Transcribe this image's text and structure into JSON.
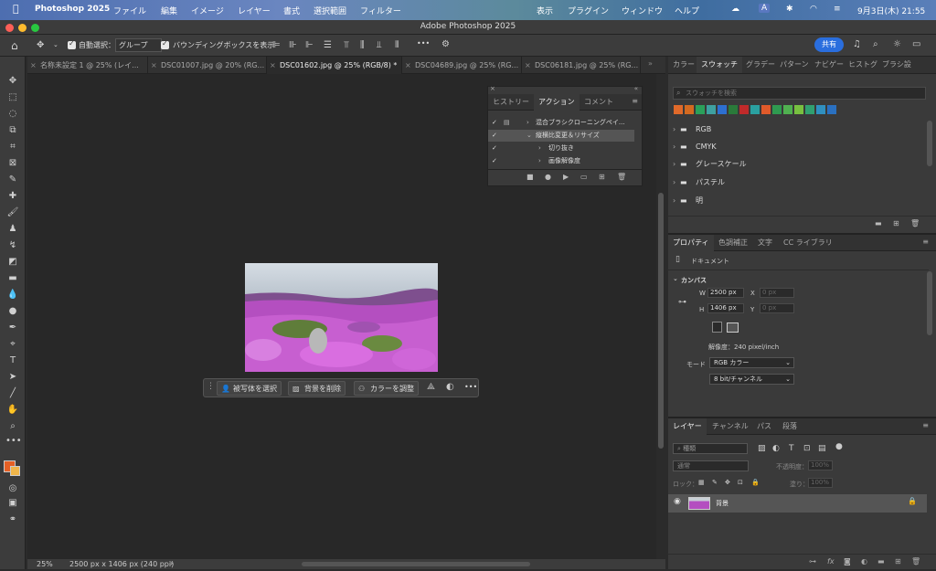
{
  "menubar": {
    "app": "Photoshop 2025",
    "items": [
      "ファイル",
      "編集",
      "イメージ",
      "レイヤー",
      "書式",
      "選択範囲",
      "フィルター"
    ],
    "right_items": [
      "表示",
      "プラグイン",
      "ウィンドウ",
      "ヘルプ"
    ],
    "input_indicator": "A",
    "datetime": "9月3日(木) 21:55"
  },
  "window": {
    "title": "Adobe Photoshop 2025"
  },
  "options": {
    "auto_select_label": "自動選択：",
    "auto_select_value": "グループ",
    "bbox_label": "バウンディングボックスを表示",
    "more": "•••",
    "share_label": "共有"
  },
  "tabs": [
    {
      "label": "名称未設定 1 @ 25% (レイ...",
      "active": false
    },
    {
      "label": "DSC01007.jpg @ 20% (RG...",
      "active": false
    },
    {
      "label": "DSC01602.jpg @ 25% (RGB/8) *",
      "active": true
    },
    {
      "label": "DSC04689.jpg @ 25% (RG...",
      "active": false
    },
    {
      "label": "DSC06181.jpg @ 25% (RG...",
      "active": false
    }
  ],
  "actions_panel": {
    "tabs": [
      "ヒストリー",
      "アクション",
      "コメント"
    ],
    "rows": [
      {
        "label": "混合ブラシクローニングペイ...",
        "level": 1,
        "open": false,
        "dialog": true
      },
      {
        "label": "縦横比変更＆リサイズ",
        "level": 1,
        "open": true,
        "selected": true
      },
      {
        "label": "切り抜き",
        "level": 2,
        "open": false
      },
      {
        "label": "画像解像度",
        "level": 2,
        "open": false
      }
    ]
  },
  "context_bar": {
    "select_subject": "被写体を選択",
    "remove_bg": "背景を削除",
    "adjust_color": "カラーを調整",
    "more": "•••"
  },
  "status": {
    "zoom": "25%",
    "info": "2500 px x 1406 px (240 ppi)"
  },
  "swatches_panel": {
    "tabs": [
      "カラー",
      "スウォッチ",
      "グラデー",
      "パターン",
      "ナビゲー",
      "ヒストグ",
      "ブラシ設"
    ],
    "search_placeholder": "スウォッチを検索",
    "colors": [
      "#e06a2a",
      "#d46a20",
      "#2aa05a",
      "#3ea0a0",
      "#2d6fd0",
      "#2a7a3a",
      "#c02a2a",
      "#2aa0a0",
      "#e05a2a",
      "#2f9a50",
      "#50b050",
      "#78c040",
      "#30a070",
      "#3090c0",
      "#2a70c0"
    ],
    "folders": [
      "RGB",
      "CMYK",
      "グレースケール",
      "パステル",
      "明"
    ]
  },
  "properties_panel": {
    "tabs": [
      "プロパティ",
      "色調補正",
      "文字",
      "CC ライブラリ"
    ],
    "doc_label": "ドキュメント",
    "canvas_label": "カンバス",
    "w_label": "W",
    "w_value": "2500 px",
    "h_label": "H",
    "h_value": "1406 px",
    "x_label": "X",
    "x_placeholder": "0 px",
    "y_label": "Y",
    "y_placeholder": "0 px",
    "resolution": "解像度：240 pixel/inch",
    "mode_label": "モード",
    "mode_value": "RGB カラー",
    "depth_value": "8 bit/チャンネル"
  },
  "layers_panel": {
    "tabs": [
      "レイヤー",
      "チャンネル",
      "パス",
      "段落"
    ],
    "filter_label": "種類",
    "blend_mode": "通常",
    "opacity_label": "不透明度：",
    "opacity_value": "100%",
    "lock_label": "ロック：",
    "fill_label": "塗り：",
    "fill_value": "100%",
    "layers": [
      {
        "name": "背景",
        "visible": true,
        "locked": true
      }
    ]
  }
}
